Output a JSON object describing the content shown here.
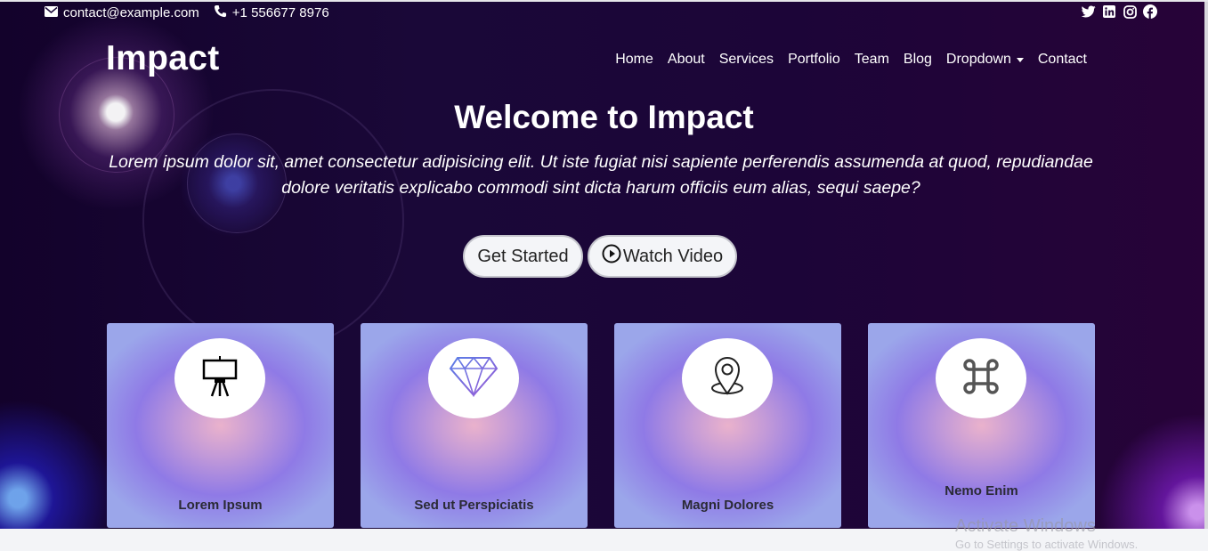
{
  "topbar": {
    "email": "contact@example.com",
    "phone": "+1 556677 8976",
    "email_icon": "envelope-icon",
    "phone_icon": "phone-icon",
    "socials": [
      "twitter-icon",
      "linkedin-icon",
      "instagram-icon",
      "facebook-icon"
    ]
  },
  "header": {
    "logo": "Impact",
    "nav": [
      "Home",
      "About",
      "Services",
      "Portfolio",
      "Team",
      "Blog",
      "Dropdown",
      "Contact"
    ]
  },
  "hero": {
    "title": "Welcome to Impact",
    "lead": "Lorem ipsum dolor sit, amet consectetur adipisicing elit. Ut iste fugiat nisi sapiente perferendis assumenda at quod, repudiandae dolore veritatis explicabo commodi sint dicta harum officiis eum alias, sequi saepe?",
    "get_started": "Get Started",
    "watch_video": "Watch Video"
  },
  "cards": [
    {
      "title": "Lorem Ipsum",
      "icon": "easel-icon"
    },
    {
      "title": "Sed ut Perspiciatis",
      "icon": "diamond-icon"
    },
    {
      "title": "Magni Dolores",
      "icon": "map-pin-icon"
    },
    {
      "title": "Nemo Enim",
      "icon": "command-icon"
    }
  ],
  "watermark": {
    "line1": "Activate Windows",
    "line2": "Go to Settings to activate Windows."
  },
  "colors": {
    "hero_dark": "#1a0838",
    "card_blue": "#8f7ae6",
    "card_pink": "#eab2cc",
    "button_bg": "#f4f5f8"
  }
}
